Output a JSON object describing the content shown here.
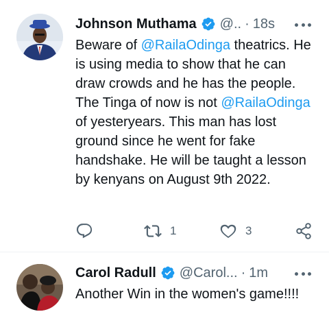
{
  "tweets": [
    {
      "name": "Johnson Muthama",
      "handle": "@..",
      "time": "18s",
      "body": {
        "p1": "Beware of ",
        "m1": "@RailaOdinga",
        "p2": " theatrics. He is using media to show that he can draw crowds and he has the people. The Tinga of now is not ",
        "m2": "@RailaOdinga",
        "p3": " of yesteryears. This man has lost ground since he went for fake handshake. He will be taught  a lesson by kenyans on August 9th 2022."
      },
      "actions": {
        "retweets": "1",
        "likes": "3"
      }
    },
    {
      "name": "Carol Radull",
      "handle": "@Carol...",
      "time": "1m",
      "body": "Another Win in the women's game!!!!"
    }
  ],
  "colors": {
    "mention": "#1d9bf0",
    "verified": "#1d9bf0",
    "muted": "#536471",
    "text": "#0f1419"
  },
  "icons": [
    "verified-badge-icon",
    "more-icon",
    "reply-icon",
    "retweet-icon",
    "like-icon",
    "share-icon"
  ]
}
